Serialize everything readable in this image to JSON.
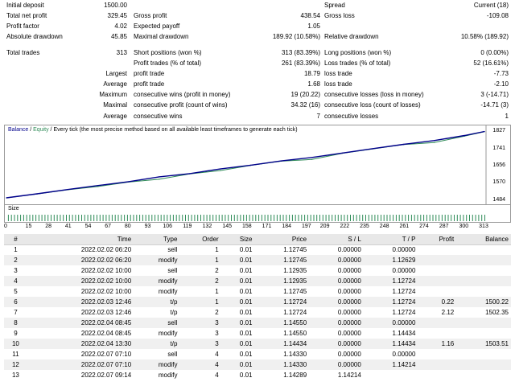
{
  "summary": {
    "initial_deposit_label": "Initial deposit",
    "initial_deposit_value": "1500.00",
    "spread_label": "Spread",
    "spread_value": "Current (18)",
    "total_net_profit_label": "Total net profit",
    "total_net_profit_value": "329.45",
    "gross_profit_label": "Gross profit",
    "gross_profit_value": "438.54",
    "gross_loss_label": "Gross loss",
    "gross_loss_value": "-109.08",
    "profit_factor_label": "Profit factor",
    "profit_factor_value": "4.02",
    "expected_payoff_label": "Expected payoff",
    "expected_payoff_value": "1.05",
    "absolute_drawdown_label": "Absolute drawdown",
    "absolute_drawdown_value": "45.85",
    "maximal_drawdown_label": "Maximal drawdown",
    "maximal_drawdown_value": "189.92 (10.58%)",
    "relative_drawdown_label": "Relative drawdown",
    "relative_drawdown_value": "10.58% (189.92)",
    "total_trades_label": "Total trades",
    "total_trades_value": "313",
    "short_positions_label": "Short positions (won %)",
    "short_positions_value": "313 (83.39%)",
    "long_positions_label": "Long positions (won %)",
    "long_positions_value": "0 (0.00%)",
    "profit_trades_label": "Profit trades (% of total)",
    "profit_trades_value": "261 (83.39%)",
    "loss_trades_label": "Loss trades (% of total)",
    "loss_trades_value": "52 (16.61%)",
    "largest_label": "Largest",
    "largest_profit_label": "profit trade",
    "largest_profit_value": "18.79",
    "largest_loss_label": "loss trade",
    "largest_loss_value": "-7.73",
    "average_label": "Average",
    "average_profit_label": "profit trade",
    "average_profit_value": "1.68",
    "average_loss_label": "loss trade",
    "average_loss_value": "-2.10",
    "maximum_label": "Maximum",
    "max_cons_wins_label": "consecutive wins (profit in money)",
    "max_cons_wins_value": "19 (20.22)",
    "max_cons_losses_label": "consecutive losses (loss in money)",
    "max_cons_losses_value": "3 (-14.71)",
    "maximal_label": "Maximal",
    "maximal_cons_profit_label": "consecutive profit (count of wins)",
    "maximal_cons_profit_value": "34.32 (16)",
    "maximal_cons_loss_label": "consecutive loss (count of losses)",
    "maximal_cons_loss_value": "-14.71 (3)",
    "average2_label": "Average",
    "avg_cons_wins_label": "consecutive wins",
    "avg_cons_wins_value": "7",
    "avg_cons_losses_label": "consecutive losses",
    "avg_cons_losses_value": "1"
  },
  "chart": {
    "legend_balance": "Balance",
    "legend_sep": " / ",
    "legend_equity": "Equity",
    "legend_rest": " / Every tick (the most precise method based on all available least timeframes to generate each tick)",
    "y_ticks": [
      "1827",
      "1741",
      "1656",
      "1570",
      "1484"
    ],
    "size_label": "Size",
    "x_ticks": [
      "0",
      "15",
      "28",
      "41",
      "54",
      "67",
      "80",
      "93",
      "106",
      "119",
      "132",
      "145",
      "158",
      "171",
      "184",
      "197",
      "209",
      "222",
      "235",
      "248",
      "261",
      "274",
      "287",
      "300",
      "313"
    ],
    "balance_color": "#00008b",
    "equity_color": "#2e8b57"
  },
  "chart_data": {
    "type": "line",
    "x_range": [
      0,
      313
    ],
    "ylim": [
      1484,
      1827
    ],
    "series": [
      {
        "name": "Balance",
        "x": [
          0,
          20,
          40,
          60,
          80,
          100,
          120,
          140,
          160,
          180,
          200,
          220,
          240,
          260,
          280,
          300,
          313
        ],
        "values": [
          1500,
          1520,
          1541,
          1561,
          1580,
          1604,
          1620,
          1643,
          1662,
          1683,
          1700,
          1722,
          1744,
          1765,
          1784,
          1809,
          1829
        ]
      },
      {
        "name": "Equity",
        "x": [
          0,
          20,
          40,
          60,
          80,
          100,
          120,
          140,
          160,
          180,
          200,
          220,
          240,
          260,
          280,
          300,
          313
        ],
        "values": [
          1500,
          1519,
          1540,
          1556,
          1578,
          1592,
          1619,
          1635,
          1661,
          1682,
          1690,
          1721,
          1743,
          1764,
          1774,
          1806,
          1828
        ]
      }
    ]
  },
  "table": {
    "headers": [
      "#",
      "Time",
      "Type",
      "Order",
      "Size",
      "Price",
      "S / L",
      "T / P",
      "Profit",
      "Balance"
    ],
    "rows": [
      [
        "1",
        "2022.02.02 06:20",
        "sell",
        "1",
        "0.01",
        "1.12745",
        "0.00000",
        "0.00000",
        "",
        ""
      ],
      [
        "2",
        "2022.02.02 06:20",
        "modify",
        "1",
        "0.01",
        "1.12745",
        "0.00000",
        "1.12629",
        "",
        ""
      ],
      [
        "3",
        "2022.02.02 10:00",
        "sell",
        "2",
        "0.01",
        "1.12935",
        "0.00000",
        "0.00000",
        "",
        ""
      ],
      [
        "4",
        "2022.02.02 10:00",
        "modify",
        "2",
        "0.01",
        "1.12935",
        "0.00000",
        "1.12724",
        "",
        ""
      ],
      [
        "5",
        "2022.02.02 10:00",
        "modify",
        "1",
        "0.01",
        "1.12745",
        "0.00000",
        "1.12724",
        "",
        ""
      ],
      [
        "6",
        "2022.02.03 12:46",
        "t/p",
        "1",
        "0.01",
        "1.12724",
        "0.00000",
        "1.12724",
        "0.22",
        "1500.22"
      ],
      [
        "7",
        "2022.02.03 12:46",
        "t/p",
        "2",
        "0.01",
        "1.12724",
        "0.00000",
        "1.12724",
        "2.12",
        "1502.35"
      ],
      [
        "8",
        "2022.02.04 08:45",
        "sell",
        "3",
        "0.01",
        "1.14550",
        "0.00000",
        "0.00000",
        "",
        ""
      ],
      [
        "9",
        "2022.02.04 08:45",
        "modify",
        "3",
        "0.01",
        "1.14550",
        "0.00000",
        "1.14434",
        "",
        ""
      ],
      [
        "10",
        "2022.02.04 13:30",
        "t/p",
        "3",
        "0.01",
        "1.14434",
        "0.00000",
        "1.14434",
        "1.16",
        "1503.51"
      ],
      [
        "11",
        "2022.02.07 07:10",
        "sell",
        "4",
        "0.01",
        "1.14330",
        "0.00000",
        "0.00000",
        "",
        ""
      ],
      [
        "12",
        "2022.02.07 07:10",
        "modify",
        "4",
        "0.01",
        "1.14330",
        "0.00000",
        "1.14214",
        "",
        ""
      ],
      [
        "13",
        "2022.02.07 09:14",
        "modify",
        "4",
        "0.01",
        "1.14289",
        "1.14214",
        "",
        "",
        ""
      ]
    ]
  }
}
